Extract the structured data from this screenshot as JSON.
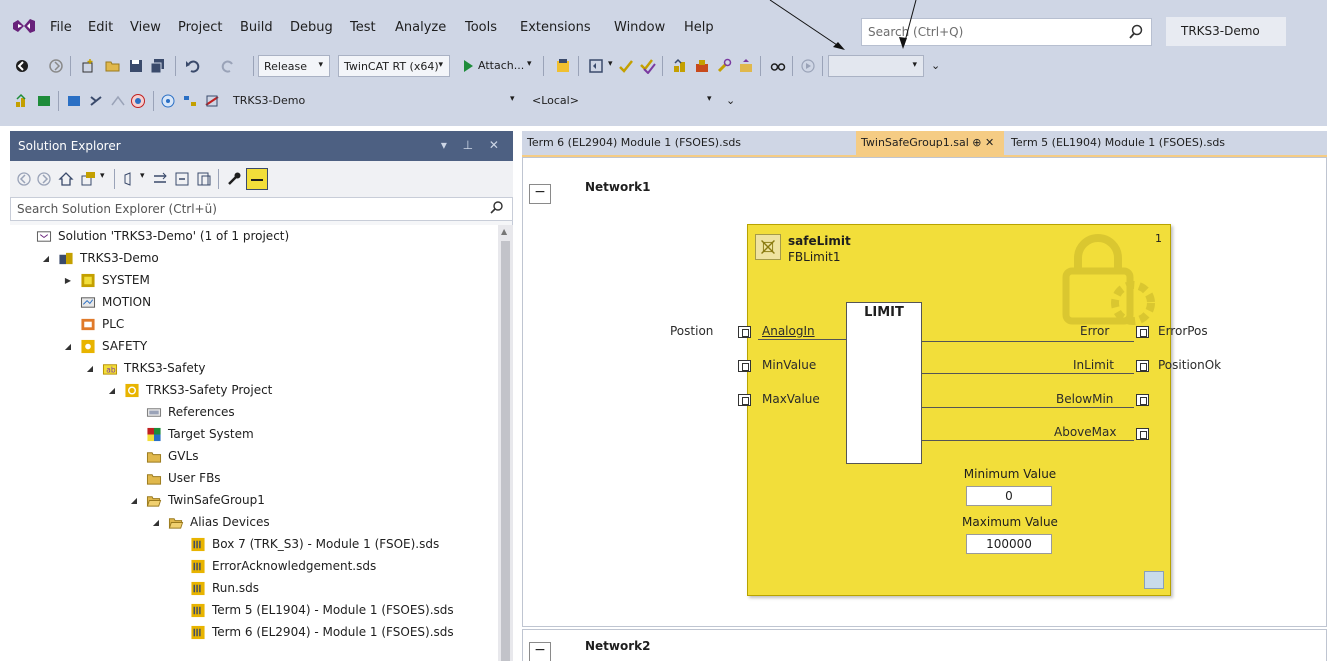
{
  "menu": {
    "items": [
      "File",
      "Edit",
      "View",
      "Project",
      "Build",
      "Debug",
      "Test",
      "Analyze",
      "Tools",
      "Extensions",
      "Window",
      "Help"
    ],
    "search_placeholder": "Search (Ctrl+Q)",
    "project_name": "TRKS3-Demo"
  },
  "toolbar1": {
    "config": "Release",
    "platform": "TwinCAT RT (x64)",
    "attach": "Attach..."
  },
  "toolbar2": {
    "target": "TRKS3-Demo",
    "system": "<Local>"
  },
  "solution_explorer": {
    "title": "Solution Explorer",
    "title_controls": "▾ ⊥ ✕",
    "search": "Search Solution Explorer (Ctrl+ü)",
    "tree": [
      {
        "label": "Solution 'TRKS3-Demo' (1 of 1 project)",
        "level": 0,
        "exp": "",
        "icon": "solution-icon"
      },
      {
        "label": "TRKS3-Demo",
        "level": 1,
        "exp": "◢",
        "icon": "twincat-project-icon"
      },
      {
        "label": "SYSTEM",
        "level": 2,
        "exp": "▶",
        "icon": "system-icon"
      },
      {
        "label": "MOTION",
        "level": 2,
        "exp": "",
        "icon": "motion-icon"
      },
      {
        "label": "PLC",
        "level": 2,
        "exp": "",
        "icon": "plc-icon"
      },
      {
        "label": "SAFETY",
        "level": 2,
        "exp": "◢",
        "icon": "safety-icon"
      },
      {
        "label": "TRKS3-Safety",
        "level": 3,
        "exp": "◢",
        "icon": "safety-project-icon"
      },
      {
        "label": "TRKS3-Safety Project",
        "level": 4,
        "exp": "◢",
        "icon": "safety-subproject-icon"
      },
      {
        "label": "References",
        "level": 5,
        "exp": "",
        "icon": "references-icon"
      },
      {
        "label": "Target System",
        "level": 5,
        "exp": "",
        "icon": "target-system-icon"
      },
      {
        "label": "GVLs",
        "level": 5,
        "exp": "",
        "icon": "folder-icon"
      },
      {
        "label": "User FBs",
        "level": 5,
        "exp": "",
        "icon": "folder-icon"
      },
      {
        "label": "TwinSafeGroup1",
        "level": 5,
        "exp": "◢",
        "icon": "folder-open-icon"
      },
      {
        "label": "Alias Devices",
        "level": 6,
        "exp": "◢",
        "icon": "folder-open-icon"
      },
      {
        "label": "Box 7 (TRK_S3) - Module 1 (FSOE).sds",
        "level": 7,
        "exp": "",
        "icon": "alias-device-icon"
      },
      {
        "label": "ErrorAcknowledgement.sds",
        "level": 7,
        "exp": "",
        "icon": "alias-device-icon"
      },
      {
        "label": "Run.sds",
        "level": 7,
        "exp": "",
        "icon": "alias-device-icon"
      },
      {
        "label": "Term 5 (EL1904) - Module 1 (FSOES).sds",
        "level": 7,
        "exp": "",
        "icon": "alias-device-icon"
      },
      {
        "label": "Term 6 (EL2904) - Module 1 (FSOES).sds",
        "level": 7,
        "exp": "",
        "icon": "alias-device-icon"
      }
    ]
  },
  "tabs": [
    {
      "label": "Term 6 (EL2904)  Module 1 (FSOES).sds",
      "active": false
    },
    {
      "label": "TwinSafeGroup1.sal  ⊕  ✕",
      "active": true
    },
    {
      "label": "Term 5 (EL1904)  Module 1 (FSOES).sds",
      "active": false
    }
  ],
  "editor": {
    "network1": "Network1",
    "network2": "Network2",
    "collapse": "−",
    "fb": {
      "type": "safeLimit",
      "instance": "FBLimit1",
      "number": "1",
      "block_title": "LIMIT",
      "inputs": [
        "AnalogIn",
        "MinValue",
        "MaxValue"
      ],
      "outputs": [
        "Error",
        "InLimit",
        "BelowMin",
        "AboveMax"
      ],
      "input_vars": [
        "Postion"
      ],
      "output_vars": [
        "ErrorPos",
        "PositionOk"
      ],
      "min_label": "Minimum Value",
      "min_value": "0",
      "max_label": "Maximum Value",
      "max_value": "100000"
    }
  },
  "colors": {
    "fb_yellow": "#f2de3a",
    "tab_active": "#f5cc84",
    "panel_title": "#4d6082",
    "chrome": "#cfd6e5"
  }
}
